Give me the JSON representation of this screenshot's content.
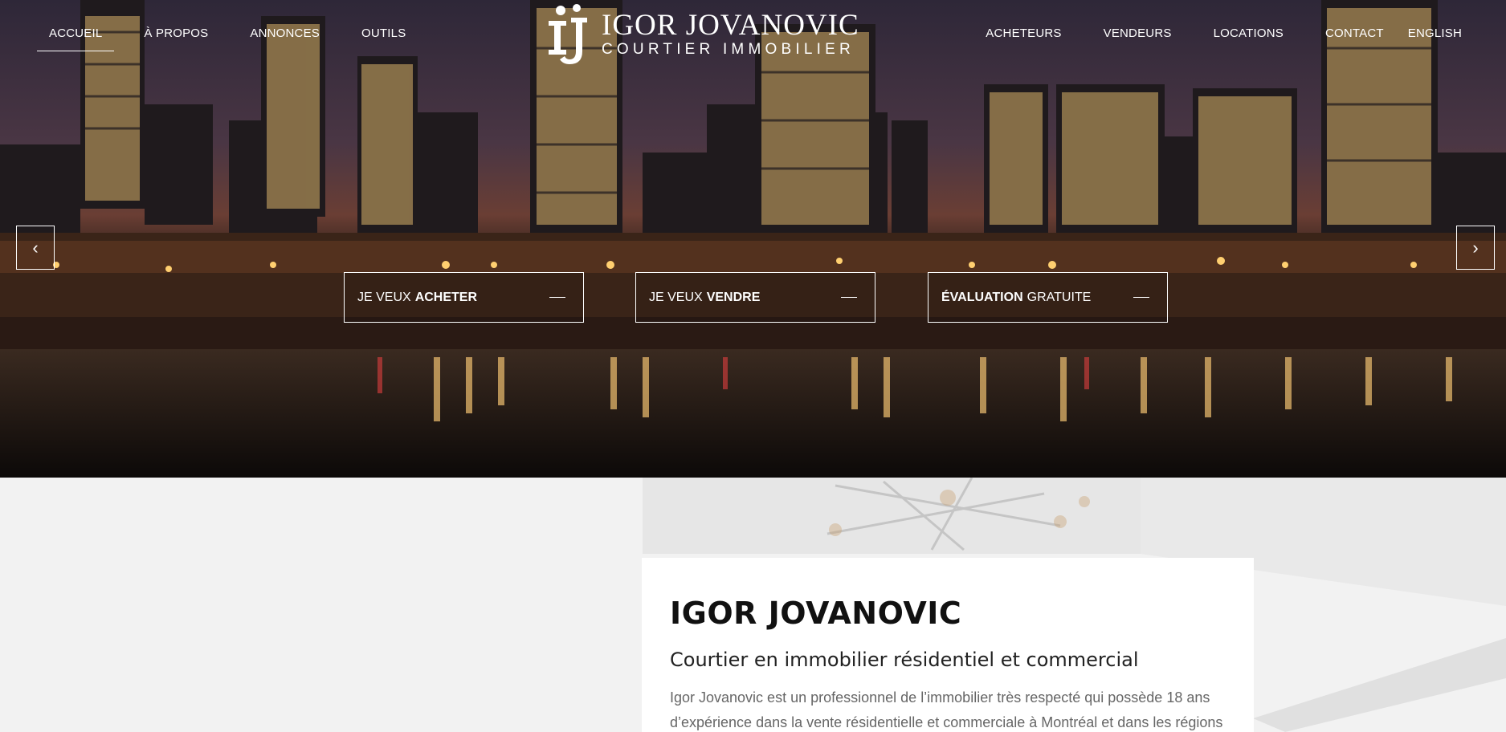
{
  "nav": {
    "left": [
      "ACCUEIL",
      "À PROPOS",
      "ANNONCES",
      "OUTILS"
    ],
    "right": [
      "ACHETEURS",
      "VENDEURS",
      "LOCATIONS",
      "CONTACT",
      "ENGLISH"
    ],
    "active": "ACCUEIL"
  },
  "logo": {
    "name": "IGOR JOVANOVIC",
    "subtitle": "COURTIER IMMOBILIER"
  },
  "carousel": {
    "prev_label": "‹",
    "next_label": "›"
  },
  "cta": [
    {
      "prefix": "JE VEUX",
      "strong": "ACHETER"
    },
    {
      "prefix": "JE VEUX",
      "strong": "VENDRE"
    },
    {
      "strong": "ÉVALUATION",
      "suffix": "GRATUITE"
    }
  ],
  "about": {
    "title": "IGOR JOVANOVIC",
    "subtitle": "Courtier en immobilier résidentiel et commercial",
    "text": "Igor Jovanovic est un professionnel de l’immobilier très respecté qui possède 18 ans d’expérience dans la vente résidentielle et commerciale à Montréal et dans les régions"
  },
  "colors": {
    "accent": "#ffffff",
    "title": "#111111",
    "body_text": "#666666"
  }
}
